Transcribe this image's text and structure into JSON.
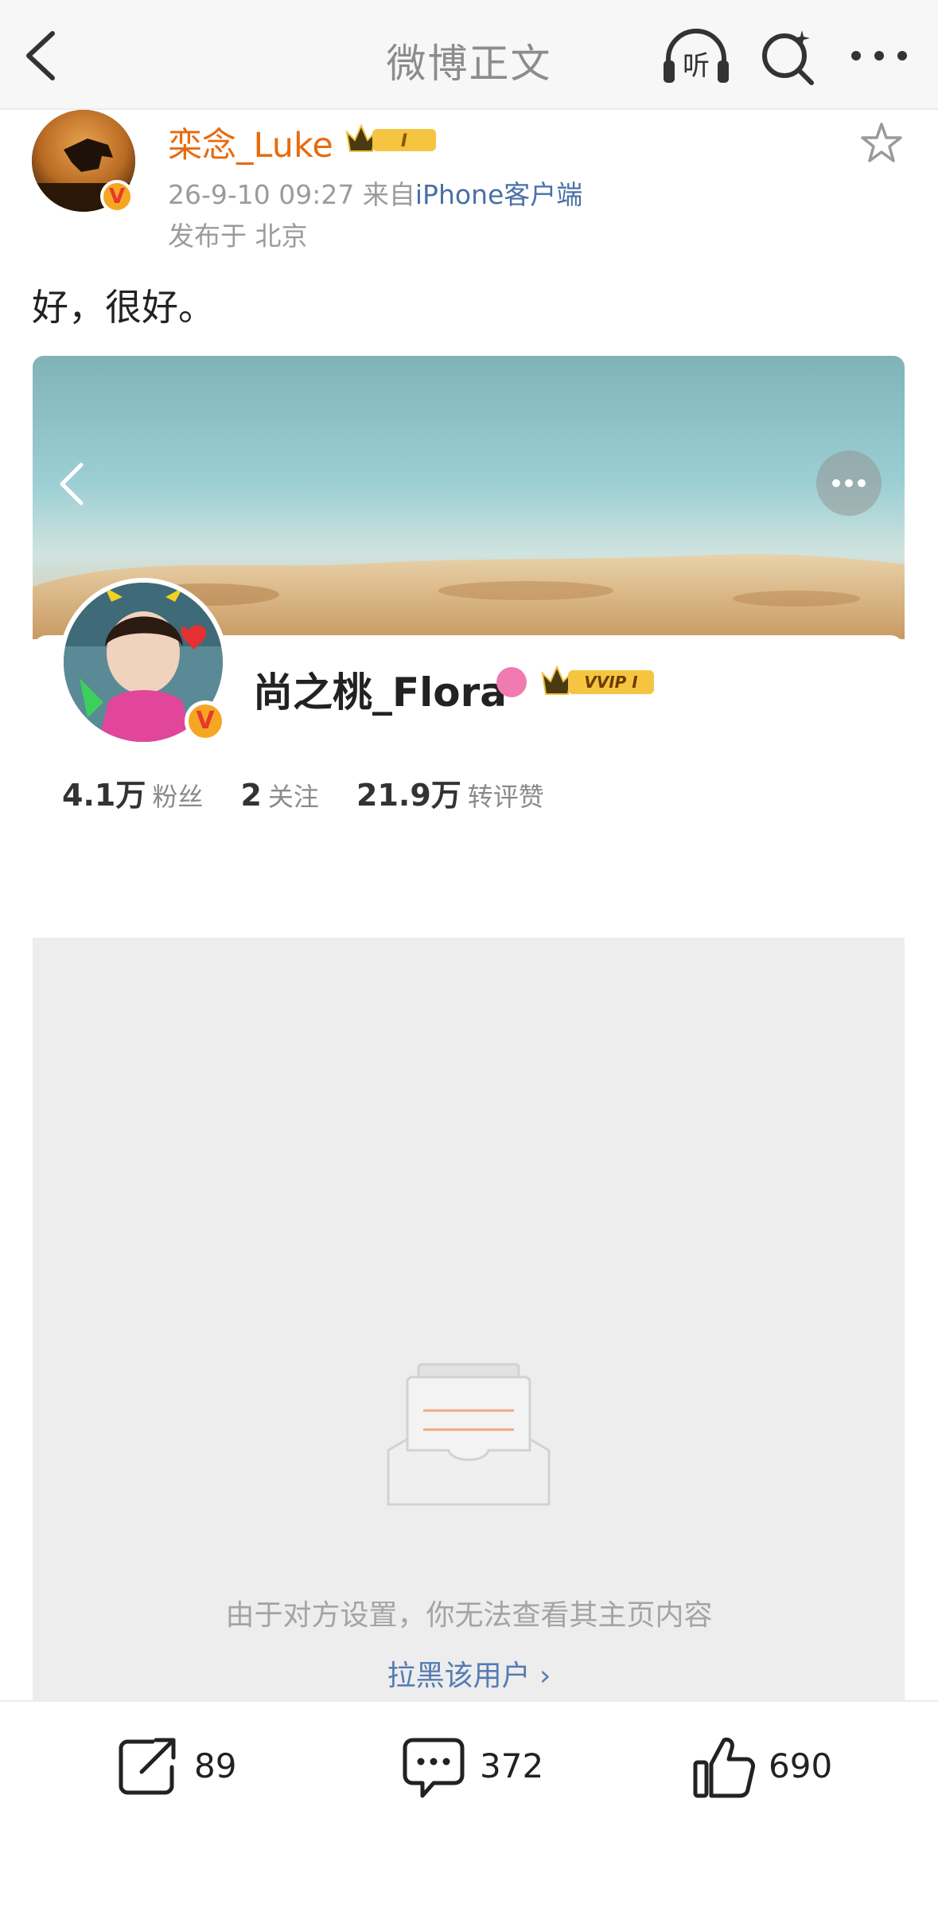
{
  "nav": {
    "title": "微博正文",
    "listen_label": "听"
  },
  "post": {
    "author_name": "栾念_Luke",
    "vip_level": "I",
    "verified_mark": "V",
    "time": "26-9-10 09:27",
    "source_prefix": "来自",
    "source_client": "iPhone客户端",
    "location": "发布于 北京",
    "text": "好，很好。"
  },
  "profile_card": {
    "name": "尚之桃_Flora",
    "vvip_label": "VVIP I",
    "verified_mark": "V",
    "stats": [
      {
        "value": "4.1万",
        "label": "粉丝"
      },
      {
        "value": "2",
        "label": "关注"
      },
      {
        "value": "21.9万",
        "label": "转评赞"
      }
    ],
    "restricted_message": "由于对方设置，你无法查看其主页内容",
    "block_link": "拉黑该用户 ›"
  },
  "actions": {
    "repost_count": "89",
    "comment_count": "372",
    "like_count": "690"
  },
  "colors": {
    "author_name": "#e86b0e",
    "link": "#557cb2",
    "verified": "#f5a623"
  }
}
